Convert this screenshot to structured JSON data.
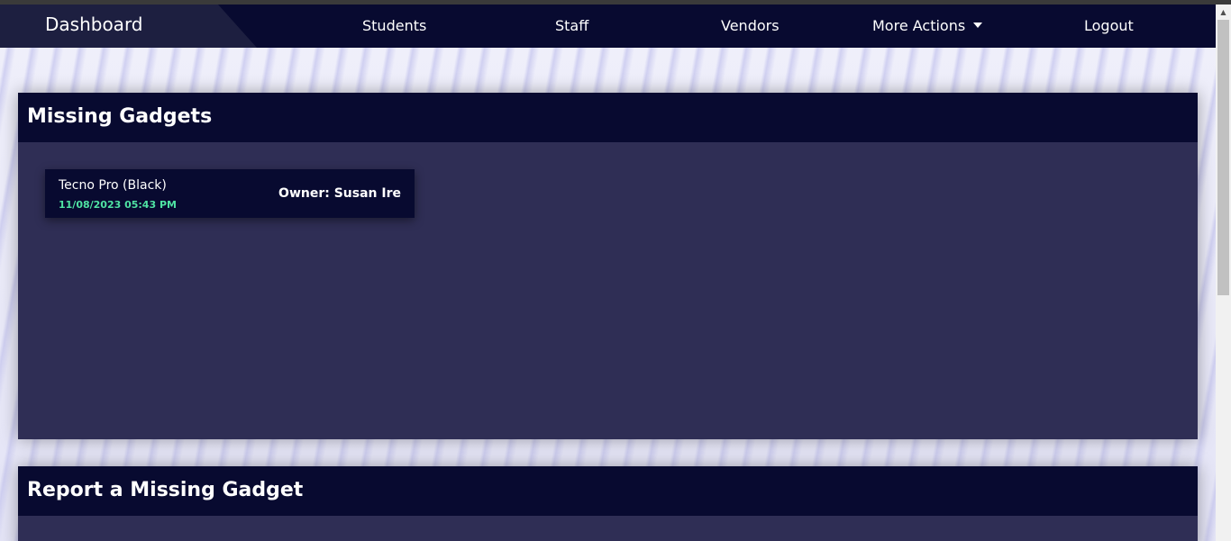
{
  "nav": {
    "brand": "Dashboard",
    "links": {
      "students": "Students",
      "staff": "Staff",
      "vendors": "Vendors",
      "more_actions": "More Actions",
      "logout": "Logout"
    }
  },
  "missing_gadgets": {
    "title": "Missing Gadgets",
    "items": [
      {
        "name": "Tecno Pro (Black)",
        "date": "11/08/2023 05:43 PM",
        "owner": "Owner: Susan Ire"
      }
    ]
  },
  "report": {
    "title": "Report a Missing Gadget"
  },
  "colors": {
    "navbar": "#080a30",
    "panel_body": "#2f2e55",
    "date_accent": "#4fe3a3"
  },
  "icons": {
    "caret": "chevron-down-icon",
    "scroll_up": "scroll-up-arrow-icon"
  }
}
